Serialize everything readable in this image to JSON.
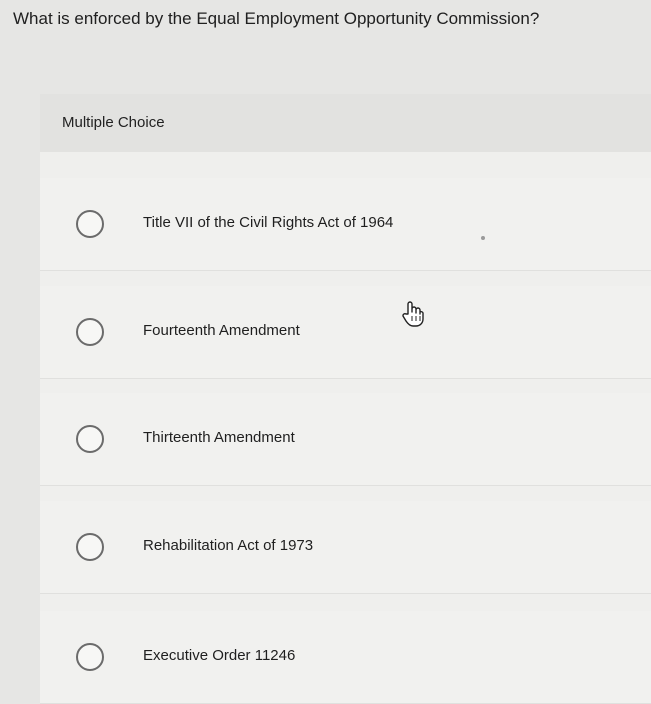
{
  "question": "What is enforced by the Equal Employment Opportunity Commission?",
  "question_type": "Multiple Choice",
  "options": [
    {
      "label": "Title VII of the Civil Rights Act of 1964"
    },
    {
      "label": "Fourteenth Amendment"
    },
    {
      "label": "Thirteenth Amendment"
    },
    {
      "label": "Rehabilitation Act of 1973"
    },
    {
      "label": "Executive Order 11246"
    }
  ],
  "cursor_icon": "hand-pointer-icon"
}
